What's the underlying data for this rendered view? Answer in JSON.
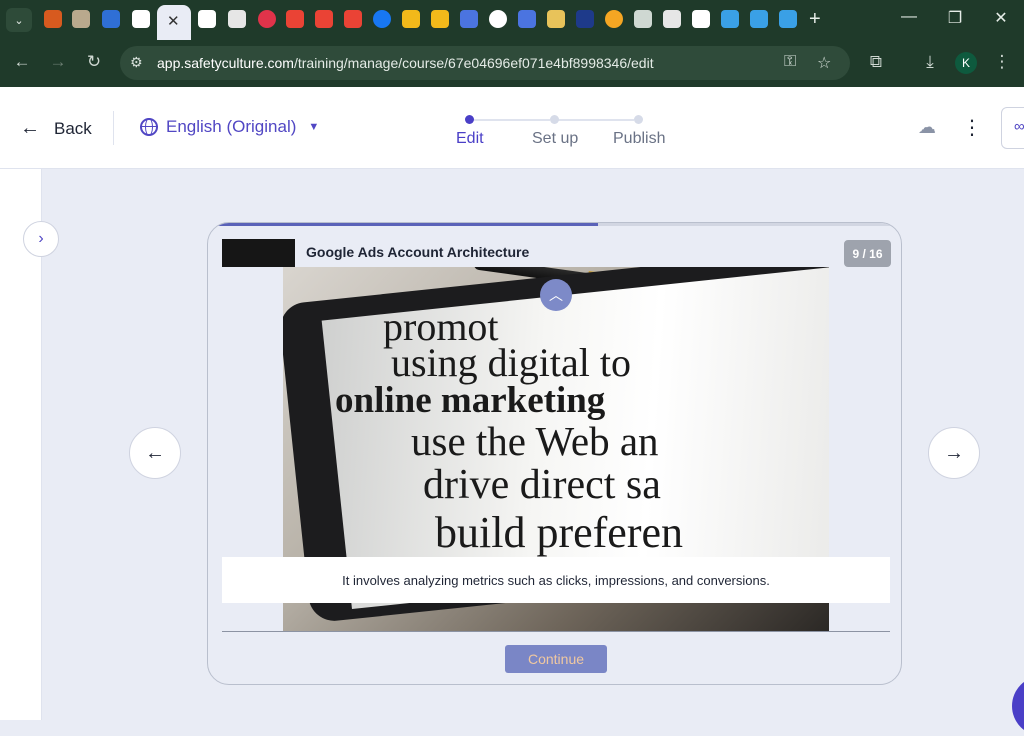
{
  "browser": {
    "tab_dropdown_icon": "chevron-down-icon",
    "active_tab_close": "✕",
    "new_tab": "+",
    "window": {
      "minimize": "—",
      "restore": "❐",
      "close": "✕"
    },
    "url_domain": "app.safetyculture.com",
    "url_path": "/training/manage/course/67e04696ef071e4bf8998346/edit",
    "profile_initial": "K"
  },
  "header": {
    "back_label": "Back",
    "language": "English (Original)",
    "steps": [
      {
        "label": "Edit",
        "active": true
      },
      {
        "label": "Set up",
        "active": false
      },
      {
        "label": "Publish",
        "active": false
      }
    ]
  },
  "course": {
    "title": "Google Ads Account Architecture",
    "counter": "9 / 16",
    "progress_fraction": 0.5625,
    "caption": "It involves analyzing metrics such as clicks, impressions, and conversions.",
    "continue_label": "Continue",
    "photo_lines": [
      "promot",
      "using digital to",
      "online marketing",
      "use the Web an",
      "drive direct sa",
      "build preferen"
    ]
  },
  "colors": {
    "browser_dark": "#1f3a2a",
    "accent": "#4a3fc7",
    "continue_bg": "#7a86c6"
  }
}
